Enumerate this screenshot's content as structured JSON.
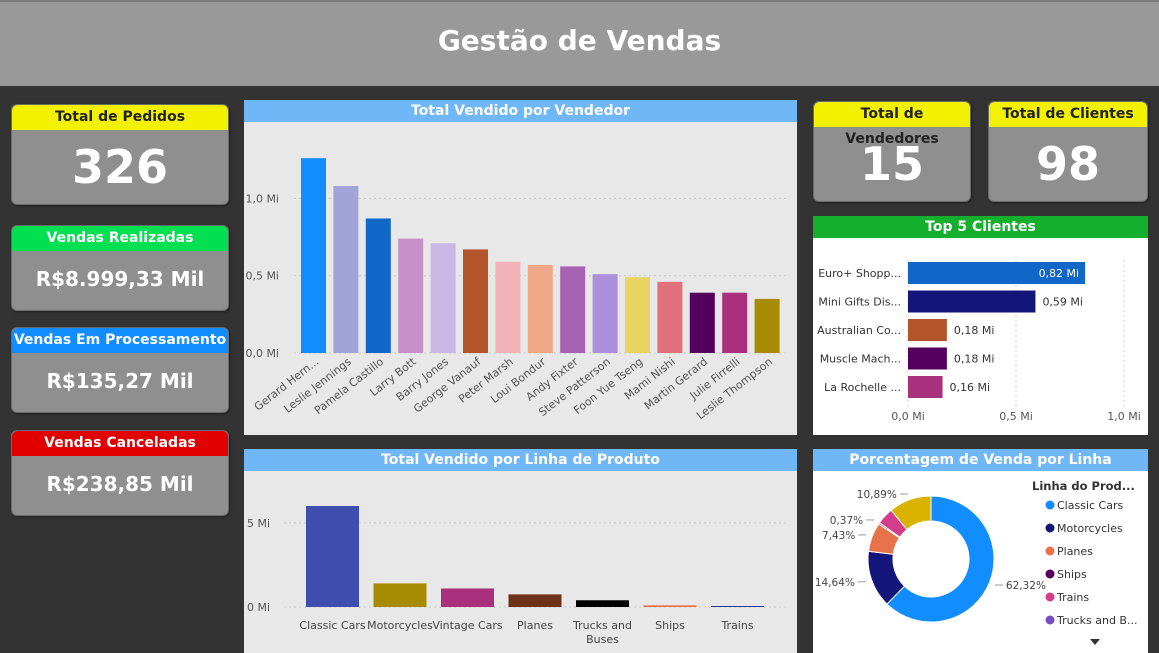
{
  "header": {
    "title": "Gestão de Vendas"
  },
  "kpis": {
    "total_pedidos": {
      "label": "Total de Pedidos",
      "value": "326"
    },
    "vendas_realizadas": {
      "label": "Vendas Realizadas",
      "value": "R$8.999,33 Mil"
    },
    "vendas_processamento": {
      "label": "Vendas Em Processamento",
      "value": "R$135,27 Mil"
    },
    "vendas_canceladas": {
      "label": "Vendas Canceladas",
      "value": "R$238,85 Mil"
    },
    "total_vendedores": {
      "label": "Total de Vendedores",
      "value": "15"
    },
    "total_clientes": {
      "label": "Total de Clientes",
      "value": "98"
    }
  },
  "colors": {
    "yellow": "#f2f200",
    "green": "#00e050",
    "blue": "#118dff",
    "red": "#e00000",
    "panel_title_blue": "#6fb7f7",
    "panel_title_green": "#14b02d"
  },
  "chart_data": [
    {
      "type": "bar",
      "title": "Total Vendido por Vendedor",
      "categories": [
        "Gerard Hern...",
        "Leslie Jennings",
        "Pamela Castillo",
        "Larry Bott",
        "Barry Jones",
        "George Vanauf",
        "Peter Marsh",
        "Loui Bondur",
        "Andy Fixter",
        "Steve Patterson",
        "Foon Yue Tseng",
        "Mami Nishi",
        "Martin Gerard",
        "Julie Firrelli",
        "Leslie Thompson"
      ],
      "values": [
        1.26,
        1.08,
        0.87,
        0.74,
        0.71,
        0.67,
        0.59,
        0.57,
        0.56,
        0.51,
        0.49,
        0.46,
        0.39,
        0.39,
        0.35
      ],
      "colors": [
        "#118dff",
        "#a0a4d9",
        "#1167c8",
        "#c591c6",
        "#c9b7e5",
        "#b3542b",
        "#f1b3b8",
        "#f1a889",
        "#a663b1",
        "#ab8fda",
        "#e8d461",
        "#e0707a",
        "#55005f",
        "#a8307c",
        "#a68a00"
      ],
      "yticks": [
        "0,0 Mi",
        "0,5 Mi",
        "1,0 Mi"
      ],
      "ylim": [
        0,
        1.3
      ],
      "grid": true
    },
    {
      "type": "bar",
      "orientation": "horizontal",
      "title": "Top 5 Clientes",
      "categories": [
        "Euro+ Shopp...",
        "Mini Gifts Dis...",
        "Australian Co...",
        "Muscle Mach...",
        "La Rochelle ..."
      ],
      "values": [
        0.82,
        0.59,
        0.18,
        0.18,
        0.16
      ],
      "labels": [
        "0,82 Mi",
        "0,59 Mi",
        "0,18 Mi",
        "0,18 Mi",
        "0,16 Mi"
      ],
      "colors": [
        "#1167c8",
        "#14157a",
        "#b3542b",
        "#55005f",
        "#a8307c"
      ],
      "xticks": [
        "0,0 Mi",
        "0,5 Mi",
        "1,0 Mi"
      ],
      "xlim": [
        0,
        1.0
      ],
      "grid": true
    },
    {
      "type": "bar",
      "title": "Total Vendido por Linha de Produto",
      "categories": [
        "Classic Cars",
        "Motorcycles",
        "Vintage Cars",
        "Planes",
        "Trucks and Buses",
        "Ships",
        "Trains"
      ],
      "values": [
        6.0,
        1.4,
        1.1,
        0.75,
        0.4,
        0.1,
        0.05
      ],
      "colors": [
        "#404eb0",
        "#a68a00",
        "#a8307c",
        "#6e3219",
        "#000000",
        "#e8734a",
        "#1f3a8a"
      ],
      "yticks": [
        "0 Mi",
        "5 Mi"
      ],
      "ylim": [
        0,
        6.5
      ],
      "grid": true
    },
    {
      "type": "pie",
      "donut": true,
      "title": "Porcentagem de Venda por Linha",
      "legend_title": "Linha do Prod...",
      "series": [
        {
          "name": "Classic Cars",
          "value": 62.32,
          "label": "62,32%",
          "color": "#118dff"
        },
        {
          "name": "Motorcycles",
          "value": 14.64,
          "label": "14,64%",
          "color": "#14157a"
        },
        {
          "name": "Planes",
          "value": 7.43,
          "label": "7,43%",
          "color": "#e8734a"
        },
        {
          "name": "Ships",
          "value": 0.37,
          "label": "0,37%",
          "color": "#55005f"
        },
        {
          "name": "Trains",
          "value": 4.35,
          "label": "",
          "color": "#d43d8a"
        },
        {
          "name": "Trucks and B...",
          "value": 0.0,
          "label": "",
          "color": "#744ec2"
        },
        {
          "name": "Vintage Cars",
          "value": 10.89,
          "label": "10,89%",
          "color": "#d9b300"
        }
      ],
      "legend_placement": "right"
    }
  ]
}
